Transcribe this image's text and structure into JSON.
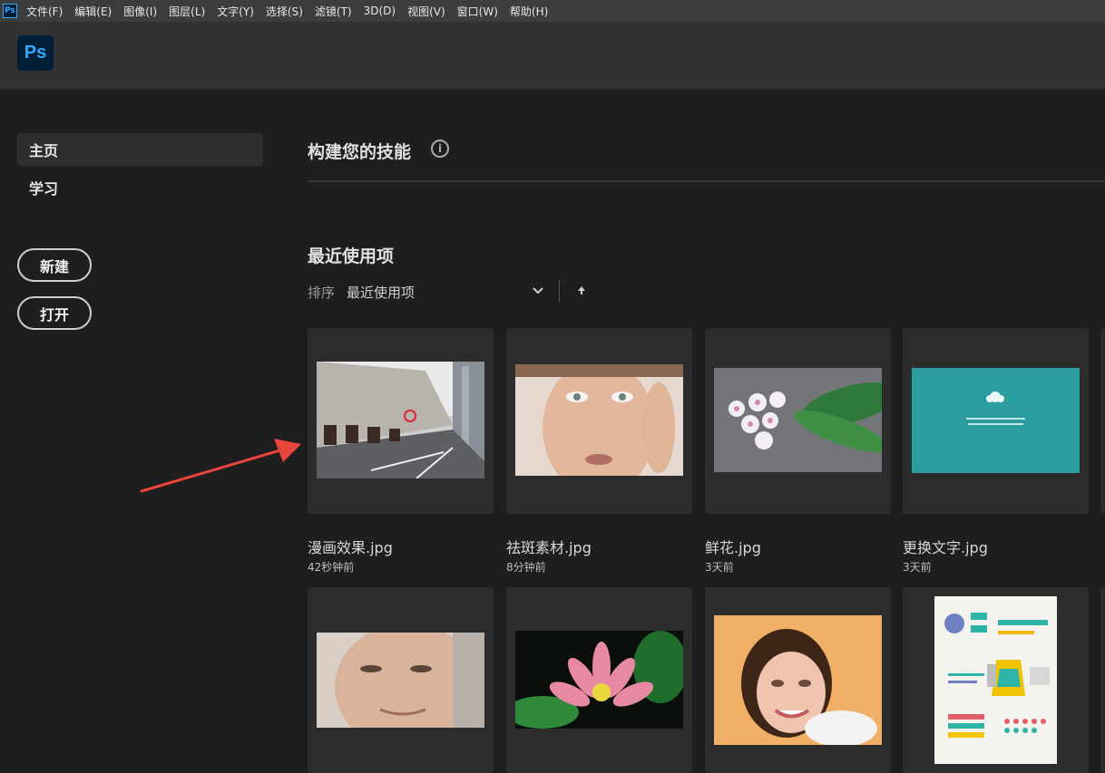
{
  "menubar": {
    "logo": "Ps",
    "items": [
      "文件(F)",
      "编辑(E)",
      "图像(I)",
      "图层(L)",
      "文字(Y)",
      "选择(S)",
      "滤镜(T)",
      "3D(D)",
      "视图(V)",
      "窗口(W)",
      "帮助(H)"
    ]
  },
  "header": {
    "logo": "Ps"
  },
  "sidebar": {
    "nav": [
      {
        "label": "主页"
      },
      {
        "label": "学习"
      }
    ],
    "new_label": "新建",
    "open_label": "打开"
  },
  "main": {
    "skills_title": "构建您的技能",
    "info_glyph": "i",
    "recent_title": "最近使用项",
    "sort_label": "排序",
    "sort_value": "最近使用项",
    "files": [
      {
        "name": "漫画效果.jpg",
        "time": "42秒钟前"
      },
      {
        "name": "祛斑素材.jpg",
        "time": "8分钟前"
      },
      {
        "name": "鲜花.jpg",
        "time": "3天前"
      },
      {
        "name": "更换文字.jpg",
        "time": "3天前"
      }
    ]
  },
  "colors": {
    "accent": "#31a8ff",
    "annotation_arrow": "#e8453c"
  }
}
